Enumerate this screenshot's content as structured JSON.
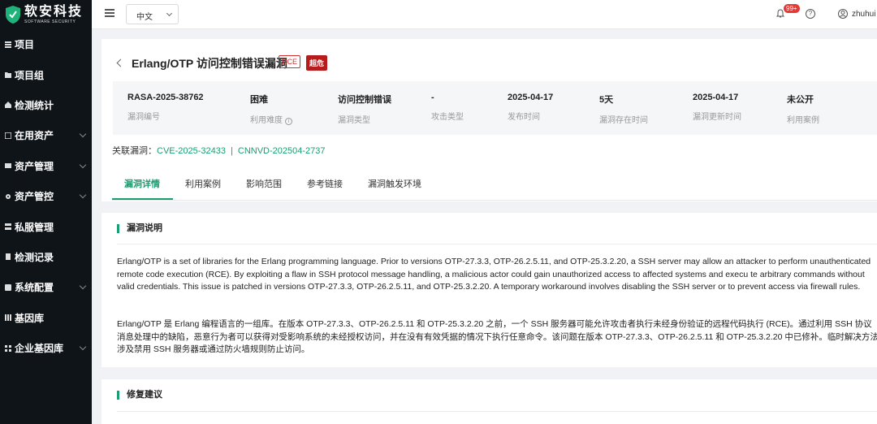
{
  "brand": {
    "name_cn": "软安科技",
    "name_en": "SOFTWARE  SECURITY"
  },
  "sidebar": {
    "items": [
      {
        "label": "项目",
        "has_children": false
      },
      {
        "label": "项目组",
        "has_children": false
      },
      {
        "label": "检测统计",
        "has_children": false
      },
      {
        "label": "在用资产",
        "has_children": true
      },
      {
        "label": "资产管理",
        "has_children": true
      },
      {
        "label": "资产管控",
        "has_children": true
      },
      {
        "label": "私服管理",
        "has_children": false
      },
      {
        "label": "检测记录",
        "has_children": false
      },
      {
        "label": "系统配置",
        "has_children": true
      },
      {
        "label": "基因库",
        "has_children": false
      },
      {
        "label": "企业基因库",
        "has_children": true
      }
    ]
  },
  "header": {
    "language": "中文",
    "notification_badge": "99+",
    "username": "zhuhui"
  },
  "vuln": {
    "title": "Erlang/OTP 访问控制错误漏洞",
    "tag_type": "RCE",
    "tag_severity": "超危",
    "info": [
      {
        "value": "RASA-2025-38762",
        "label": "漏洞编号"
      },
      {
        "value": "困难",
        "label": "利用难度"
      },
      {
        "value": "访问控制错误",
        "label": "漏洞类型"
      },
      {
        "value": "-",
        "label": "攻击类型"
      },
      {
        "value": "2025-04-17",
        "label": "发布时间"
      },
      {
        "value": "5天",
        "label": "漏洞存在时间"
      },
      {
        "value": "2025-04-17",
        "label": "漏洞更新时间"
      },
      {
        "value": "未公开",
        "label": "利用案例"
      }
    ],
    "related_label": "关联漏洞：",
    "related": [
      "CVE-2025-32433",
      "CNNVD-202504-2737"
    ],
    "related_sep": "|"
  },
  "tabs": [
    "漏洞详情",
    "利用案例",
    "影响范围",
    "参考链接",
    "漏洞触发环境"
  ],
  "description": {
    "title": "漏洞说明",
    "text_en": "Erlang/OTP is a set of libraries for the Erlang programming language. Prior to versions OTP-27.3.3, OTP-26.2.5.11, and OTP-25.3.2.20, a SSH server may allow an attacker to perform unauthenticated remote code execution (RCE). By exploiting a flaw in SSH protocol message handling, a malicious actor could gain unauthorized access to affected systems and execu te arbitrary commands without valid credentials. This issue is patched in versions OTP-27.3.3, OTP-26.2.5.11, and OTP-25.3.2.20. A temporary workaround involves disabling the SSH server or to prevent access via firewall rules.",
    "text_cn": "Erlang/OTP 是 Erlang 编程语言的一组库。在版本 OTP-27.3.3、OTP-26.2.5.11 和 OTP-25.3.2.20 之前，一个 SSH 服务器可能允许攻击者执行未经身份验证的远程代码执行 (RCE)。通过利用 SSH 协议消息处理中的缺陷，恶意行为者可以获得对受影响系统的未经授权访问，并在没有有效凭据的情况下执行任意命令。该问题在版本 OTP-27.3.3、OTP-26.2.5.11 和 OTP-25.3.2.20 中已修补。临时解决方法涉及禁用 SSH 服务器或通过防火墙规则防止访问。"
  },
  "fix": {
    "title": "修复建议"
  },
  "colors": {
    "accent": "#1a9e6f",
    "sidebar_bg": "#0f1419",
    "critical": "#b71c1c",
    "rce": "#d32f2f"
  }
}
